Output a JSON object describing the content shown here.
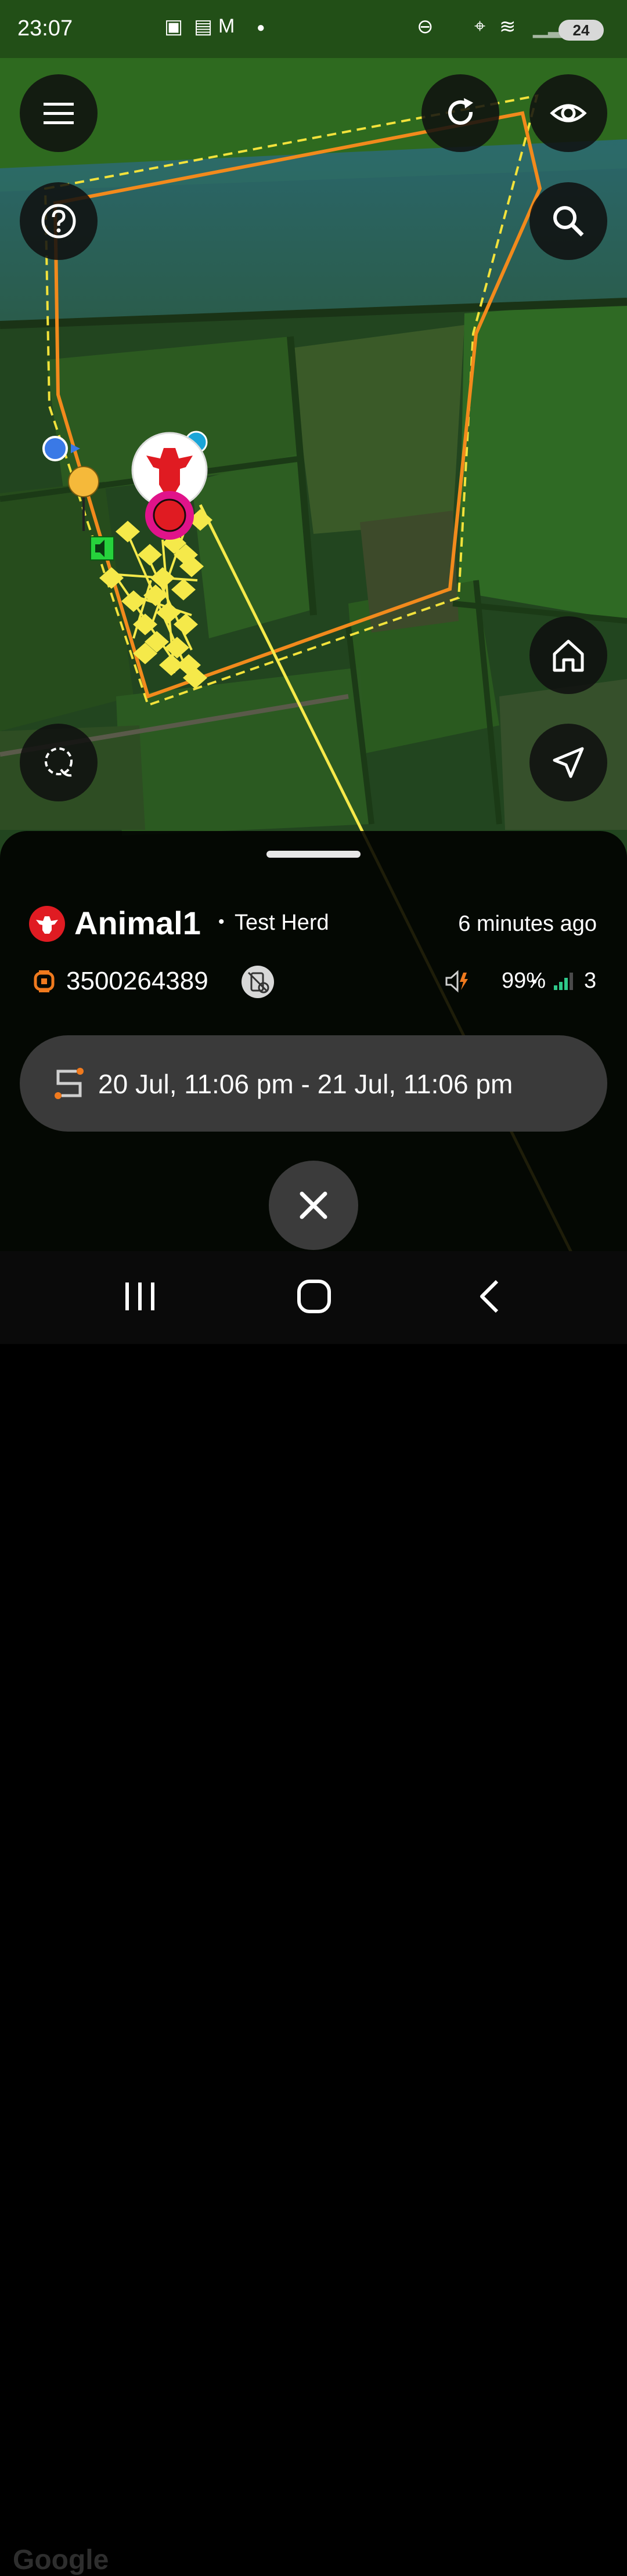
{
  "status_bar": {
    "time": "23:07",
    "battery_level": "24",
    "icons": [
      "screenshot-icon",
      "lock-icon",
      "gmail-icon",
      "dot-icon",
      "dnd-icon",
      "location-icon",
      "wifi-icon",
      "signal-icon",
      "battery-icon"
    ]
  },
  "map": {
    "provider": "Google",
    "boundary_color": "#f28a1c",
    "dashed_boundary_color": "#f2e23b",
    "track_color": "#f5e94a",
    "marker_color": "#e0138a"
  },
  "controls": {
    "left": [
      "menu-icon",
      "help-icon",
      "lasso-icon"
    ],
    "right": [
      "refresh-icon",
      "eye-icon",
      "search-icon",
      "home-icon",
      "navigate-icon"
    ]
  },
  "animal": {
    "name": "Animal1",
    "separator": "•",
    "herd": "Test Herd",
    "last_seen": "6 minutes ago",
    "device_id": "3500264389",
    "battery": "99%",
    "signal_separator": "•",
    "signal": "3"
  },
  "date_range": {
    "label": "20 Jul, 11:06 pm - 21 Jul, 11:06 pm"
  },
  "colors": {
    "accent": "#f07a1e",
    "cow_red": "#e01b22",
    "signal_green": "#2fc98a"
  }
}
